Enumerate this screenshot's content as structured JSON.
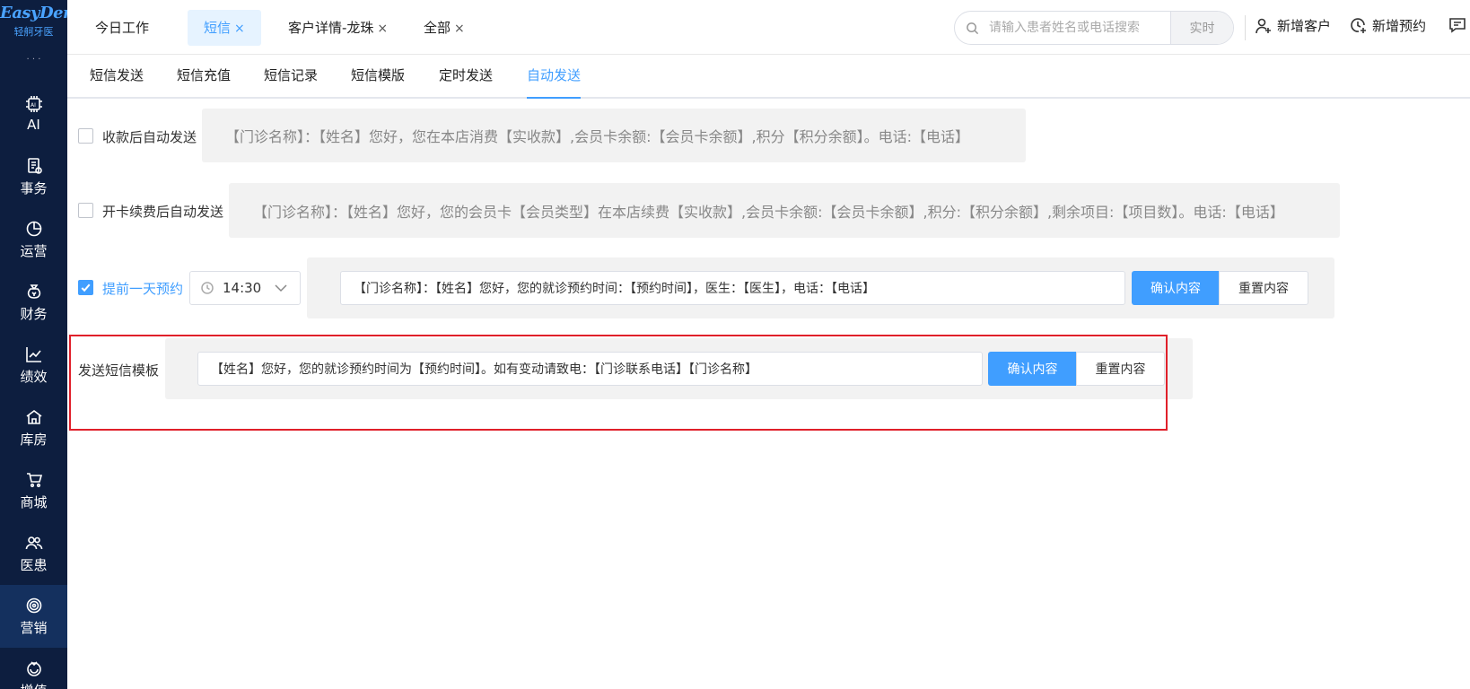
{
  "brand": {
    "name": "EasyDent",
    "subtitle": "轻舸牙医"
  },
  "sidebar": {
    "items": [
      {
        "label": "AI",
        "icon": "ai-chip-icon"
      },
      {
        "label": "事务",
        "icon": "task-icon"
      },
      {
        "label": "运营",
        "icon": "pie-chart-icon"
      },
      {
        "label": "财务",
        "icon": "money-bag-icon"
      },
      {
        "label": "绩效",
        "icon": "line-chart-icon"
      },
      {
        "label": "库房",
        "icon": "warehouse-icon"
      },
      {
        "label": "商城",
        "icon": "cart-icon"
      },
      {
        "label": "医患",
        "icon": "users-icon"
      },
      {
        "label": "营销",
        "icon": "target-icon",
        "active": true
      },
      {
        "label": "增值",
        "icon": "value-added-icon"
      }
    ]
  },
  "topbar": {
    "tabs": [
      {
        "label": "今日工作",
        "closable": false
      },
      {
        "label": "短信",
        "closable": true,
        "active": true
      },
      {
        "label": "客户详情-龙珠",
        "closable": true
      },
      {
        "label": "全部",
        "closable": true
      }
    ],
    "close_glyph": "×",
    "search_placeholder": "请输入患者姓名或电话搜索",
    "realtime_label": "实时",
    "add_customer": "新增客户",
    "add_appointment": "新增预约"
  },
  "subtabs": [
    "短信发送",
    "短信充值",
    "短信记录",
    "短信模版",
    "定时发送",
    "自动发送"
  ],
  "subtabs_active": "自动发送",
  "rows": {
    "payment": {
      "label": "收款后自动发送",
      "checked": false,
      "template": "【门诊名称】：【姓名】您好，您在本店消费【实收款】,会员卡余额:【会员卡余额】,积分【积分余额】。电话:【电话】"
    },
    "card_renewal": {
      "label": "开卡续费后自动发送",
      "checked": false,
      "template": "【门诊名称】：【姓名】您好，您的会员卡【会员类型】在本店续费【实收款】,会员卡余额:【会员卡余额】,积分:【积分余额】,剩余项目:【项目数】。电话:【电话】"
    },
    "reminder": {
      "label": "提前一天预约",
      "checked": true,
      "time": "14:30",
      "template": "【门诊名称】：【姓名】您好，您的就诊预约时间：【预约时间】，医生：【医生】，电话：【电话】",
      "confirm_label": "确认内容",
      "reset_label": "重置内容"
    },
    "send_template": {
      "label": "发送短信模板",
      "template": "【姓名】您好，您的就诊预约时间为【预约时间】。如有变动请致电：【门诊联系电话】【门诊名称】",
      "confirm_label": "确认内容",
      "reset_label": "重置内容"
    }
  },
  "colors": {
    "sidebar_bg": "#0d1e3f",
    "accent": "#409eff",
    "highlight": "#e0202a"
  }
}
